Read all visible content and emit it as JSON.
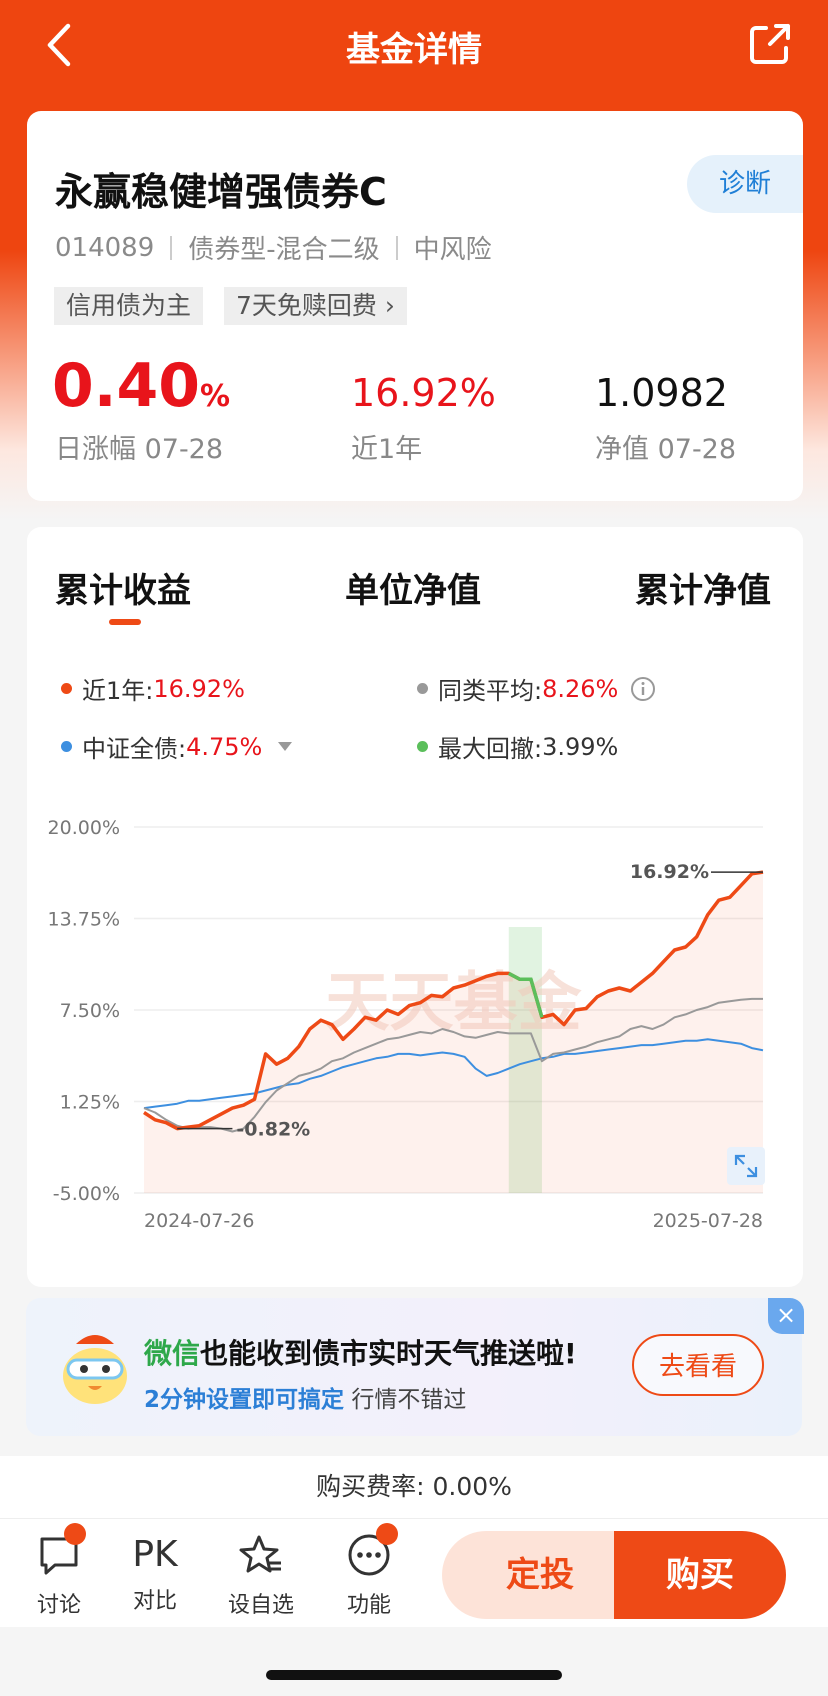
{
  "nav": {
    "title": "基金详情"
  },
  "fund": {
    "name": "永赢稳健增强债券C",
    "diagnose_label": "诊断",
    "code": "014089",
    "type": "债券型-混合二级",
    "risk": "中风险",
    "tags": [
      "信用债为主",
      "7天免赎回费 ›"
    ],
    "daily_change": "0.40",
    "daily_change_unit": "%",
    "daily_change_label": "日涨幅 07-28",
    "one_year_return": "16.92%",
    "one_year_label": "近1年",
    "nav_value": "1.0982",
    "nav_label": "净值 07-28"
  },
  "tabs": [
    "累计收益",
    "单位净值",
    "累计净值"
  ],
  "legend": {
    "l1_label": "近1年:",
    "l1_value": "16.92%",
    "l2_label": "同类平均:",
    "l2_value": "8.26%",
    "l3_label": "中证全债:",
    "l3_value": "4.75%",
    "l4_label": "最大回撤:",
    "l4_value": "3.99%"
  },
  "colors": {
    "fund": "#ee4a16",
    "peer": "#999999",
    "index": "#3d8fe0",
    "drawdown": "#5bbf5b"
  },
  "chart_data": {
    "type": "line",
    "x_start": "2024-07-26",
    "x_end": "2025-07-28",
    "y_ticks": [
      "20.00%",
      "13.75%",
      "7.50%",
      "1.25%",
      "-5.00%"
    ],
    "ylim": [
      -5,
      20
    ],
    "annotations": {
      "max_label": "16.92%",
      "min_label": "-0.82%"
    },
    "series": [
      {
        "name": "近1年",
        "values": [
          0.5,
          0.0,
          -0.2,
          -0.6,
          -0.5,
          -0.4,
          0.0,
          0.4,
          0.8,
          1.0,
          1.4,
          4.5,
          3.8,
          4.2,
          5.0,
          6.2,
          6.8,
          6.5,
          5.5,
          6.2,
          7.0,
          6.8,
          7.5,
          7.2,
          7.8,
          8.0,
          8.5,
          8.4,
          9.0,
          9.2,
          9.5,
          9.8,
          10.0,
          10.0,
          9.6,
          9.6,
          7.0,
          7.2,
          6.5,
          7.5,
          7.6,
          8.4,
          8.8,
          9.0,
          8.8,
          9.4,
          10.0,
          10.8,
          11.6,
          11.8,
          12.5,
          14.0,
          15.0,
          15.2,
          16.0,
          16.8,
          16.92
        ]
      },
      {
        "name": "同类平均",
        "values": [
          0.8,
          0.5,
          0.0,
          -0.4,
          -0.6,
          -0.5,
          -0.5,
          -0.6,
          -0.8,
          -0.6,
          0.2,
          1.2,
          2.0,
          2.5,
          3.0,
          3.2,
          3.5,
          4.0,
          4.2,
          4.6,
          4.9,
          5.2,
          5.5,
          5.6,
          5.8,
          6.0,
          5.9,
          6.2,
          6.0,
          5.7,
          5.6,
          5.8,
          6.0,
          5.9,
          5.9,
          5.9,
          4.0,
          4.5,
          4.6,
          4.8,
          5.0,
          5.3,
          5.5,
          5.7,
          6.2,
          6.4,
          6.2,
          6.5,
          7.0,
          7.2,
          7.5,
          7.7,
          8.0,
          8.1,
          8.2,
          8.26,
          8.26
        ]
      },
      {
        "name": "中证全债",
        "values": [
          0.8,
          0.9,
          1.0,
          1.1,
          1.3,
          1.3,
          1.4,
          1.5,
          1.6,
          1.7,
          1.8,
          2.0,
          2.2,
          2.4,
          2.5,
          2.8,
          3.0,
          3.3,
          3.6,
          3.8,
          4.0,
          4.2,
          4.3,
          4.5,
          4.5,
          4.4,
          4.5,
          4.6,
          4.5,
          4.3,
          3.5,
          3.0,
          3.2,
          3.5,
          3.8,
          4.0,
          4.2,
          4.3,
          4.5,
          4.5,
          4.6,
          4.7,
          4.8,
          4.9,
          5.0,
          5.1,
          5.1,
          5.2,
          5.3,
          5.4,
          5.4,
          5.5,
          5.4,
          5.3,
          5.2,
          4.9,
          4.75
        ]
      }
    ]
  },
  "promo": {
    "title_green": "微信",
    "title_rest": "也能收到债市实时天气推送啦!",
    "sub_blue": "2分钟设置即可搞定",
    "sub_rest": "行情不错过",
    "button": "去看看",
    "close": "×"
  },
  "fee": {
    "label": "购买费率: 0.00%"
  },
  "bottom": {
    "items": [
      "讨论",
      "对比",
      "设自选",
      "功能"
    ],
    "pk_text": "PK",
    "btn_sip": "定投",
    "btn_buy": "购买"
  }
}
